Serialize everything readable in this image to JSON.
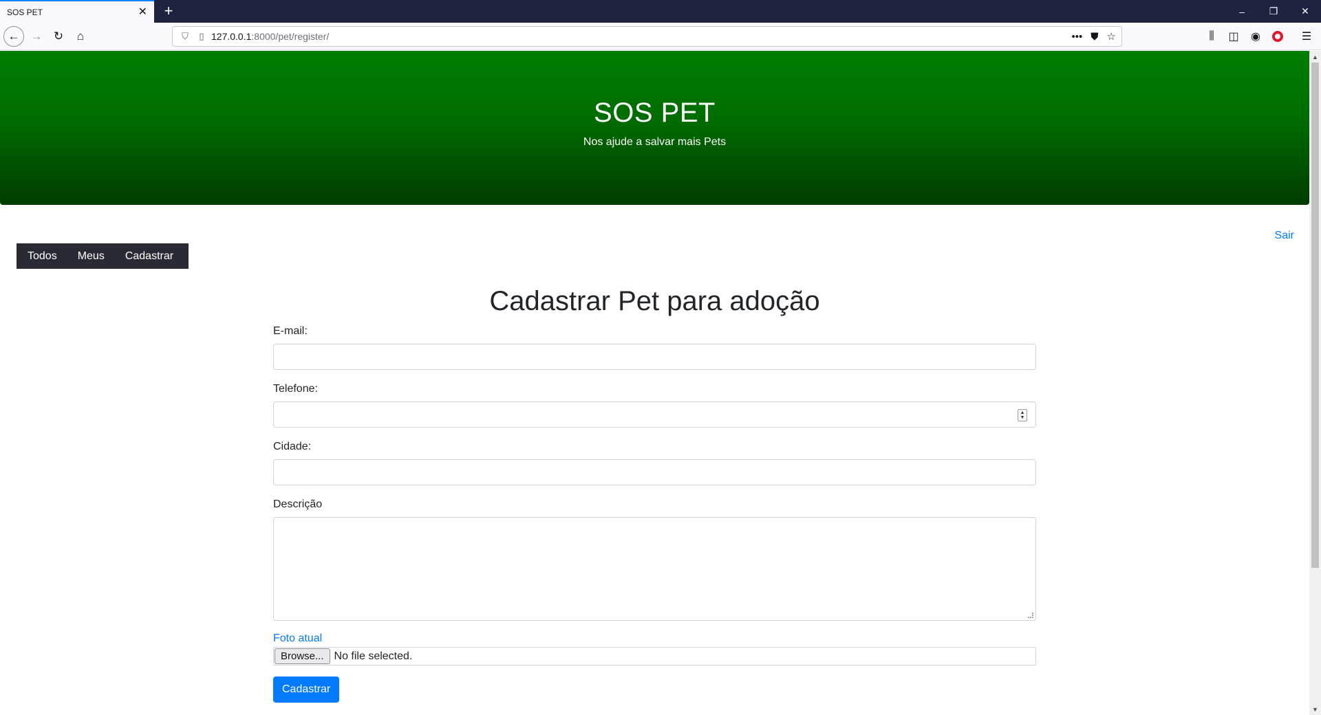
{
  "browser": {
    "tab_title": "SOS PET",
    "url_host": "127.0.0.1",
    "url_path": ":8000/pet/register/"
  },
  "hero": {
    "title": "SOS PET",
    "subtitle": "Nos ajude a salvar mais Pets"
  },
  "auth": {
    "logout_label": "Sair"
  },
  "menu": {
    "items": [
      {
        "label": "Todos"
      },
      {
        "label": "Meus"
      },
      {
        "label": "Cadastrar"
      }
    ]
  },
  "form": {
    "title": "Cadastrar Pet para adoção",
    "email_label": "E-mail:",
    "email_value": "",
    "phone_label": "Telefone:",
    "phone_value": "",
    "city_label": "Cidade:",
    "city_value": "",
    "description_label": "Descrição",
    "description_value": "",
    "photo_link": "Foto atual",
    "browse_label": "Browse...",
    "file_status": "No file selected.",
    "submit_label": "Cadastrar"
  },
  "colors": {
    "hero_top": "#007e00",
    "hero_bottom": "#003c00",
    "menu_bg": "#292a33",
    "link": "#007bff",
    "button": "#007bff",
    "titlebar": "#202340"
  },
  "icons": {
    "tab_close": "close-icon",
    "new_tab": "plus-icon",
    "back": "arrow-left-icon",
    "forward": "arrow-right-icon",
    "reload": "reload-icon",
    "home": "home-icon",
    "shield": "shield-icon",
    "page": "page-icon",
    "more": "ellipsis-icon",
    "pocket": "pocket-icon",
    "bookmark": "star-icon",
    "library": "library-icon",
    "sidebar": "sidebar-icon",
    "account": "account-icon",
    "opera": "opera-icon",
    "menu": "hamburger-icon"
  }
}
